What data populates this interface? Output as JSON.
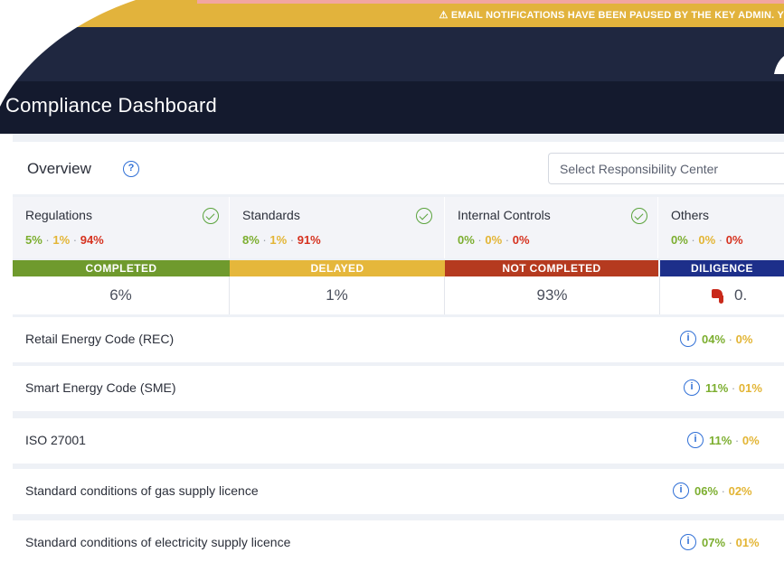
{
  "banner": {
    "text": "⚠ EMAIL NOTIFICATIONS HAVE BEEN PAUSED BY THE KEY ADMIN. Y"
  },
  "header": {
    "title": "Compliance Dashboard"
  },
  "overview": {
    "title": "Overview",
    "help_icon": "?",
    "responsibility_select": {
      "placeholder": "Select Responsibility Center"
    }
  },
  "categories": [
    {
      "label": "Regulations",
      "completed": "5%",
      "delayed": "1%",
      "not_completed": "94%",
      "icon": "check-circle-icon"
    },
    {
      "label": "Standards",
      "completed": "8%",
      "delayed": "1%",
      "not_completed": "91%",
      "icon": "check-circle-icon"
    },
    {
      "label": "Internal Controls",
      "completed": "0%",
      "delayed": "0%",
      "not_completed": "0%",
      "icon": "check-circle-icon"
    },
    {
      "label": "Others",
      "completed": "0%",
      "delayed": "0%",
      "not_completed": "0%"
    }
  ],
  "summary": [
    {
      "status": "COMPLETED",
      "value": "6%",
      "color": "#6f9a2d"
    },
    {
      "status": "DELAYED",
      "value": "1%",
      "color": "#e5b73b"
    },
    {
      "status": "NOT COMPLETED",
      "value": "93%",
      "color": "#b53a1f"
    },
    {
      "status": "DILIGENCE",
      "value": "0.",
      "color": "#1d2f8a",
      "icon": "thumbs-down-icon"
    }
  ],
  "items": [
    {
      "label": "Retail Energy Code (REC)",
      "completed": "04%",
      "delayed": "0%"
    },
    {
      "label": "Smart Energy Code (SME)",
      "completed": "11%",
      "delayed": "01%"
    },
    {
      "label": "ISO 27001",
      "completed": "11%",
      "delayed": "0%"
    },
    {
      "label": "Standard conditions of gas supply licence",
      "completed": "06%",
      "delayed": "02%"
    },
    {
      "label": "Standard conditions of electricity supply licence",
      "completed": "07%",
      "delayed": "01%"
    }
  ],
  "colors": {
    "completed": "#7cae2f",
    "delayed": "#e3b535",
    "not_completed": "#d6321f",
    "header": "#141a2e",
    "banner": "#e2b33c"
  }
}
